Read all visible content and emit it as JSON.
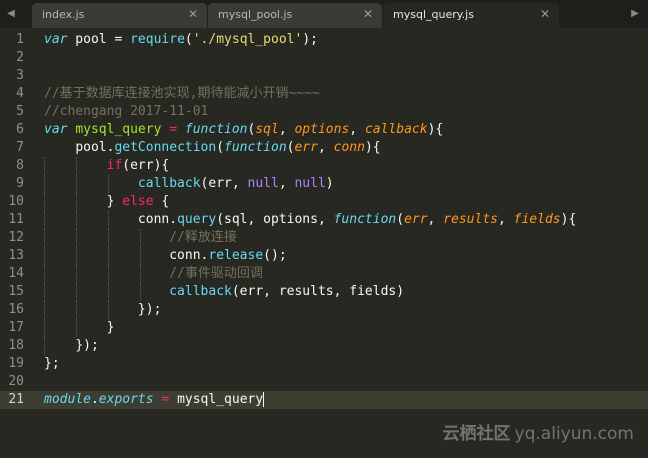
{
  "tabs": [
    {
      "label": "index.js",
      "active": false
    },
    {
      "label": "mysql_pool.js",
      "active": false
    },
    {
      "label": "mysql_query.js",
      "active": true
    }
  ],
  "tab_close_glyph": "✕",
  "tab_arrow_left": "◀",
  "tab_arrow_right": "▶",
  "line_numbers": [
    "1",
    "2",
    "3",
    "4",
    "5",
    "6",
    "7",
    "8",
    "9",
    "10",
    "11",
    "12",
    "13",
    "14",
    "15",
    "16",
    "17",
    "18",
    "19",
    "20",
    "21"
  ],
  "current_line": "21",
  "code": {
    "l1": {
      "kw_var": "var",
      "t1": " pool = ",
      "fn_require": "require",
      "t2": "(",
      "str": "'./mysql_pool'",
      "t3": ");"
    },
    "l4": {
      "comment": "//基于数据库连接池实现,期待能减小开销~~~~"
    },
    "l5": {
      "comment": "//chengang 2017-11-01"
    },
    "l6": {
      "kw_var": "var",
      "sp": " ",
      "name": "mysql_query",
      "eq": " = ",
      "kw_function": "function",
      "lp": "(",
      "p1": "sql",
      "c1": ", ",
      "p2": "options",
      "c2": ", ",
      "p3": "callback",
      "rp": "){"
    },
    "l7": {
      "t1": "pool.",
      "call": "getConnection",
      "lp": "(",
      "kw_function": "function",
      "lp2": "(",
      "p1": "err",
      "c1": ", ",
      "p2": "conn",
      "rp": "){"
    },
    "l8": {
      "kw_if": "if",
      "t1": "(err){"
    },
    "l9": {
      "call": "callback",
      "t1": "(err, ",
      "n1": "null",
      "c1": ", ",
      "n2": "null",
      "rp": ")"
    },
    "l10": {
      "t1": "} ",
      "kw_else": "else",
      "t2": " {"
    },
    "l11": {
      "t1": "conn.",
      "call": "query",
      "t2": "(sql, options, ",
      "kw_function": "function",
      "lp": "(",
      "p1": "err",
      "c1": ", ",
      "p2": "results",
      "c2": ", ",
      "p3": "fields",
      "rp": "){"
    },
    "l12": {
      "comment": "//释放连接"
    },
    "l13": {
      "t1": "conn.",
      "call": "release",
      "t2": "();"
    },
    "l14": {
      "comment": "//事件驱动回调"
    },
    "l15": {
      "call": "callback",
      "t1": "(err, results, fields)"
    },
    "l16": {
      "t1": "});"
    },
    "l17": {
      "t1": "}"
    },
    "l18": {
      "t1": "});"
    },
    "l19": {
      "t1": "};"
    },
    "l21": {
      "mod": "module",
      "dot": ".",
      "exports": "exports",
      "eq": " = ",
      "name": "mysql_query"
    }
  },
  "watermark": {
    "brand": "云栖社区",
    "domain": "yq.aliyun.com"
  },
  "colors": {
    "background": "#272822",
    "keyword": "#f92672",
    "storage": "#66d9ef",
    "function_name": "#a6e22e",
    "parameter": "#fd971f",
    "string": "#e6db74",
    "comment": "#75715e",
    "constant": "#ae81ff"
  }
}
